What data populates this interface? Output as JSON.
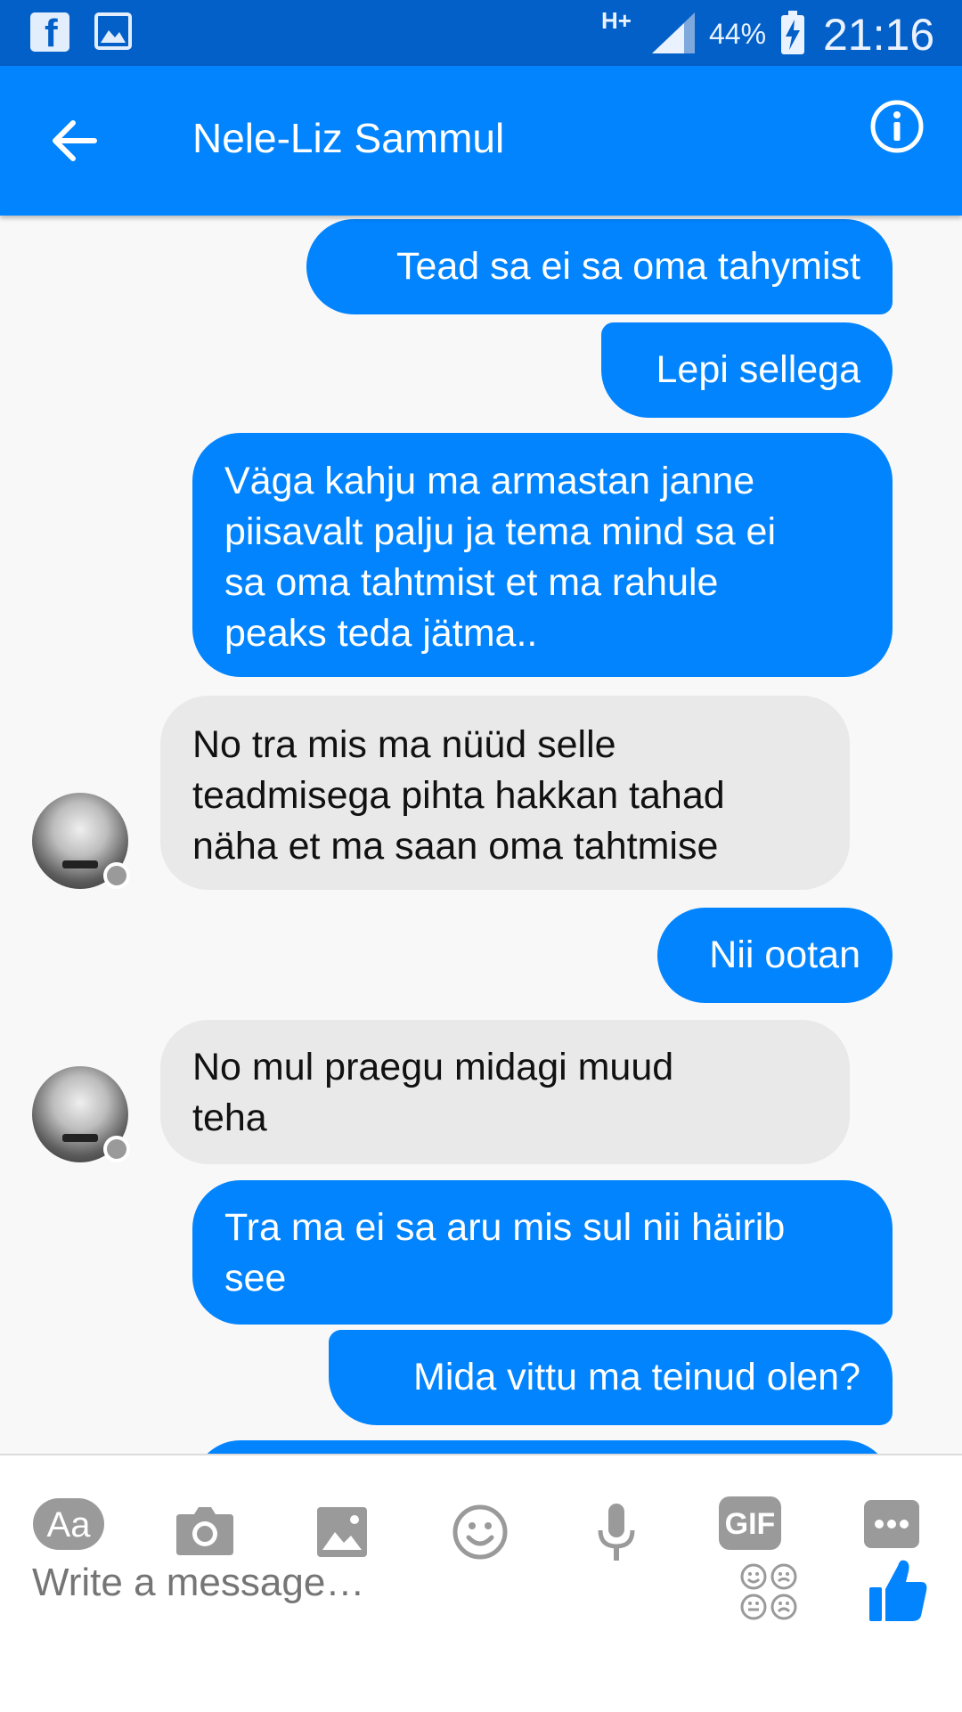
{
  "status_bar": {
    "network": "H+",
    "battery": "44%",
    "time": "21:16"
  },
  "header": {
    "title": "Nele-Liz Sammul"
  },
  "messages": [
    {
      "from": "me",
      "lines": [
        "Tead sa ei sa oma tahymist"
      ]
    },
    {
      "from": "me",
      "lines": [
        "Lepi sellega"
      ]
    },
    {
      "from": "me",
      "lines": [
        "Väga kahju ma armastan janne",
        "piisavalt palju ja tema mind sa ei",
        "sa oma tahtmist et ma rahule",
        "peaks teda jätma.."
      ]
    },
    {
      "from": "them",
      "lines": [
        "No tra mis ma nüüd selle",
        "teadmisega pihta hakkan tahad",
        "näha et ma saan oma tahtmise"
      ]
    },
    {
      "from": "me",
      "lines": [
        "Nii ootan"
      ]
    },
    {
      "from": "them",
      "lines": [
        "No mul praegu midagi muud",
        "teha"
      ]
    },
    {
      "from": "me",
      "lines": [
        "Tra ma ei sa aru mis sul nii häirib",
        "see"
      ]
    },
    {
      "from": "me",
      "lines": [
        "Mida vittu ma teinud olen?"
      ]
    }
  ],
  "composer": {
    "text_tool_label": "Aa",
    "gif_label": "GIF",
    "placeholder": "Write a message…"
  },
  "colors": {
    "status_bar": "#0260c8",
    "header": "#0284ff",
    "outgoing_bubble": "#0284ff",
    "incoming_bubble": "#e9e9e9",
    "like_button": "#0284ff"
  },
  "icons": [
    "facebook-icon",
    "gallery-icon",
    "signal-icon",
    "battery-icon",
    "back-arrow-icon",
    "info-icon",
    "camera-icon",
    "image-icon",
    "emoji-icon",
    "microphone-icon",
    "more-icon",
    "stickers-icon",
    "thumbs-up-icon"
  ]
}
